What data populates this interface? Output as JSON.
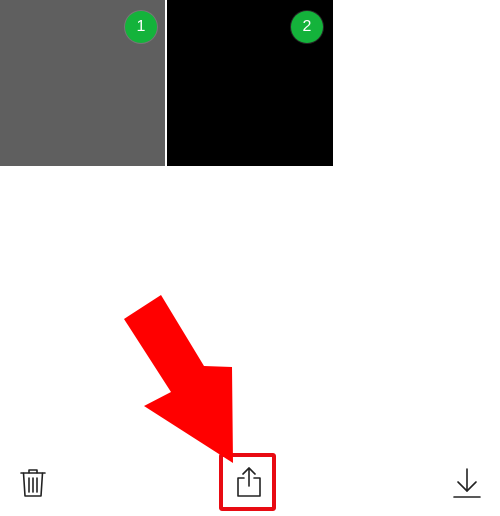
{
  "photos": [
    {
      "badge": "1",
      "color": "#5f5f5f"
    },
    {
      "badge": "2",
      "color": "#000000"
    }
  ],
  "badge_color": "#14b33b",
  "toolbar": {
    "trash_icon": "trash-icon",
    "share_icon": "share-icon",
    "download_icon": "download-icon"
  },
  "annotation": {
    "arrow_color": "#ff0000",
    "highlight_color": "#e80a12",
    "highlights": "share-button"
  }
}
